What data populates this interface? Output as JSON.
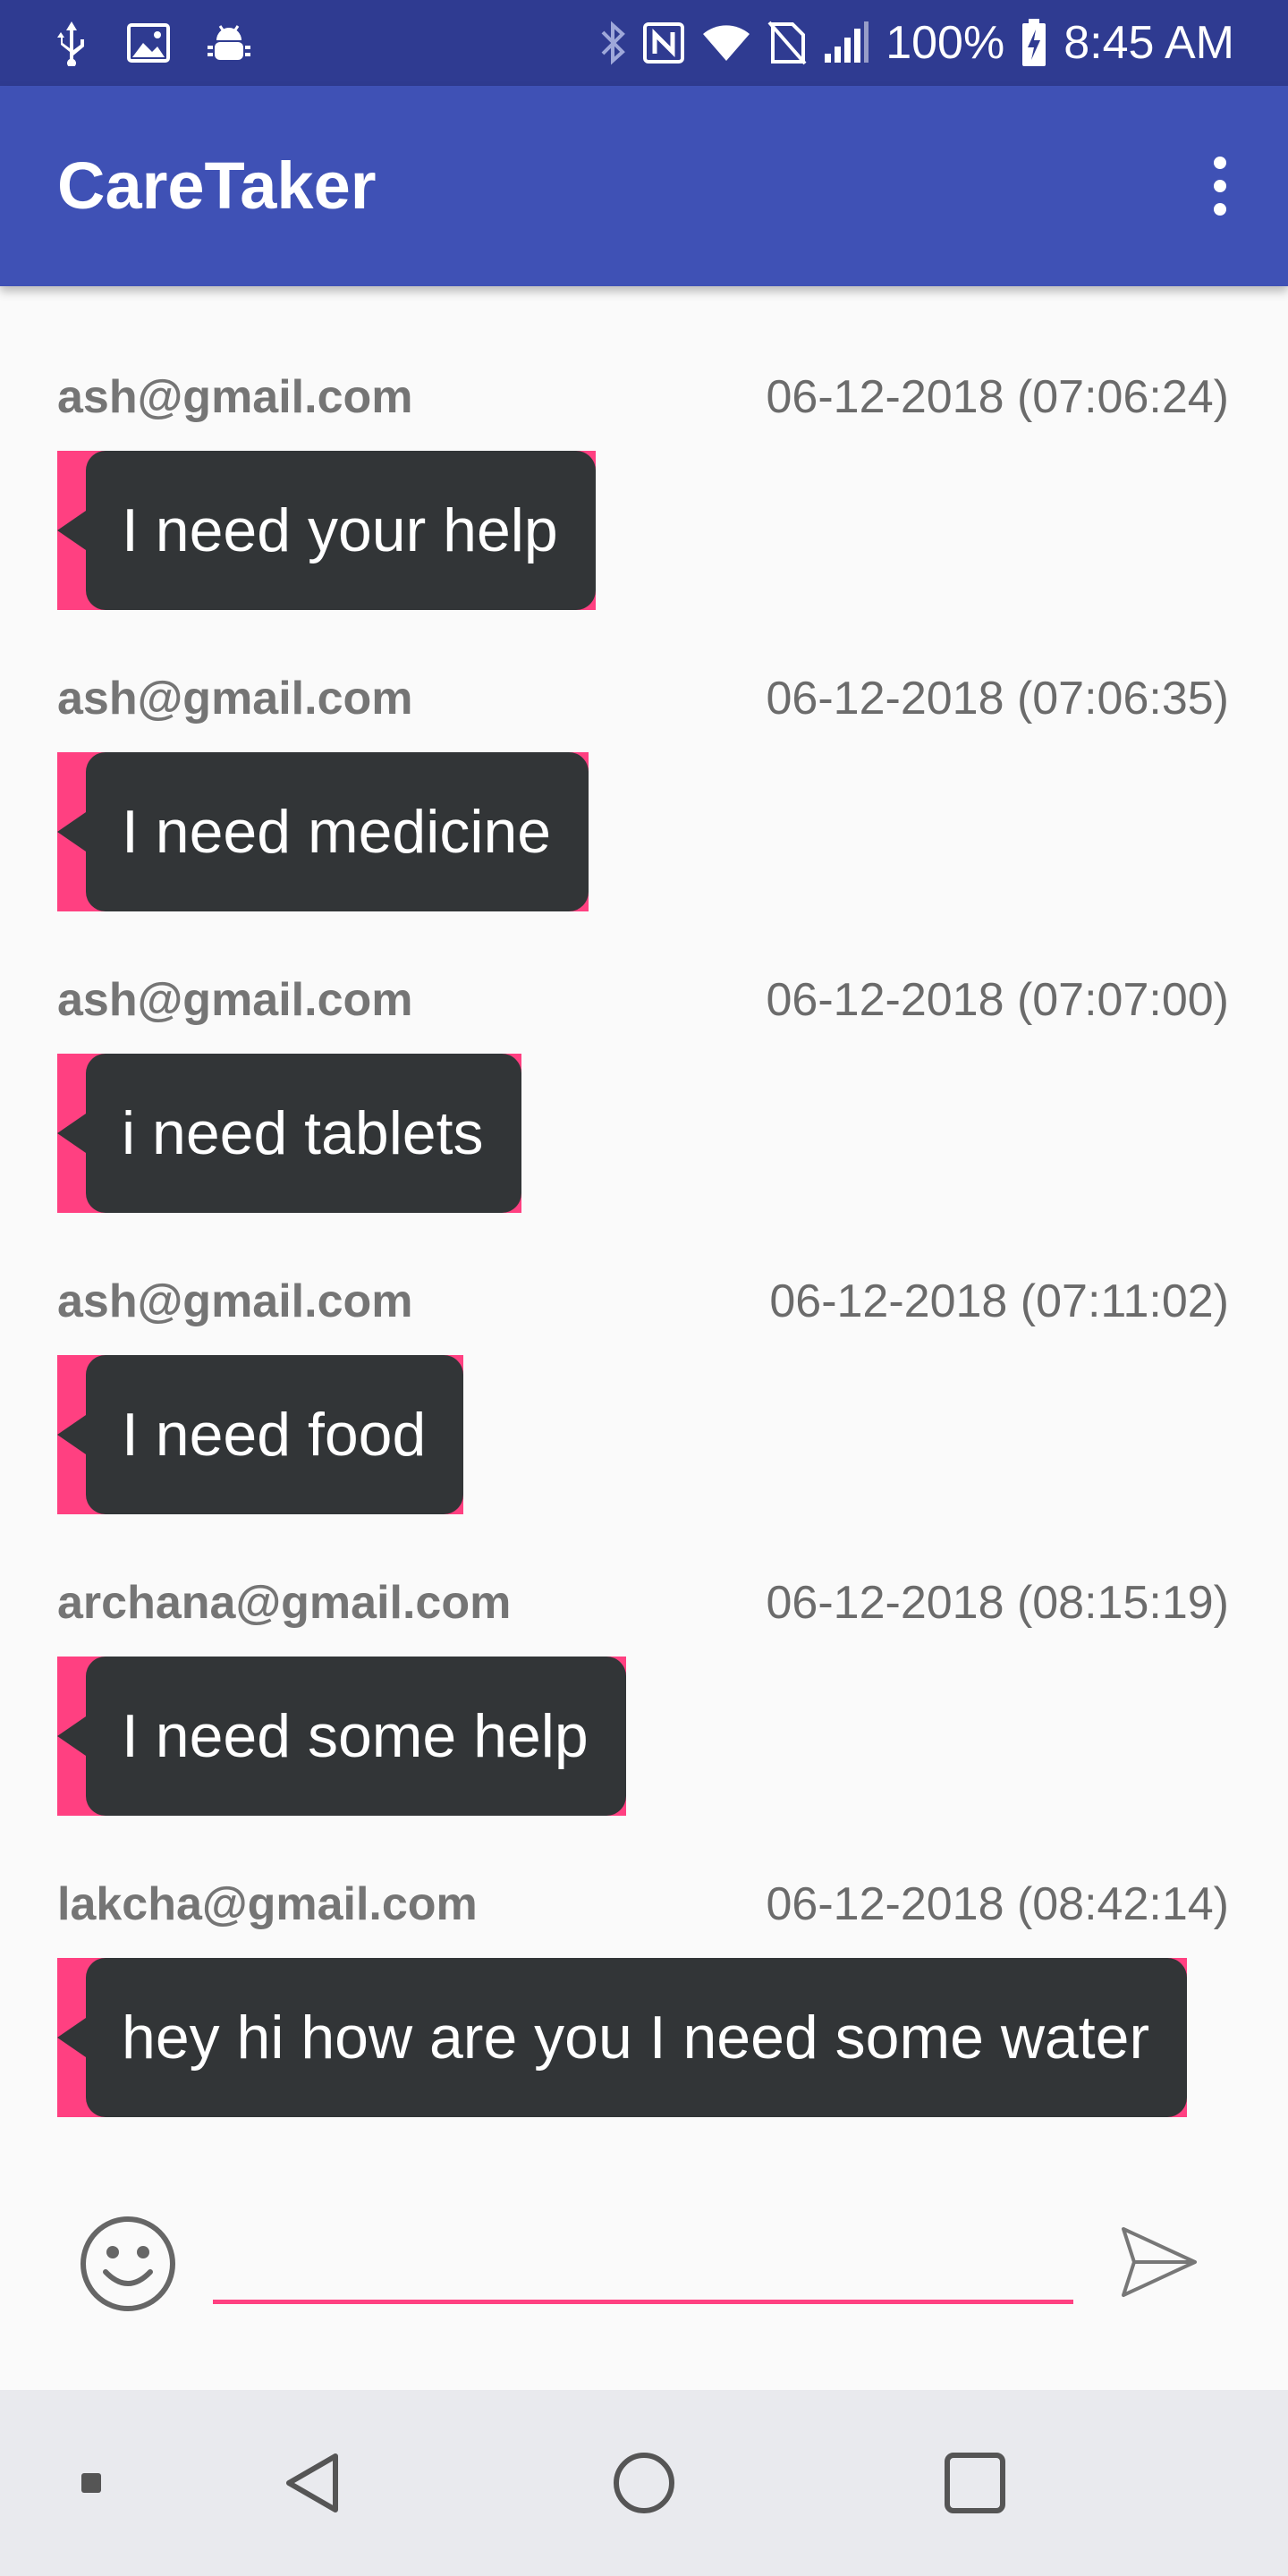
{
  "status_bar": {
    "battery": "100%",
    "time": "8:45 AM",
    "icons": [
      "usb-icon",
      "image-icon",
      "android-debug-icon",
      "bluetooth-icon",
      "nfc-icon",
      "wifi-icon",
      "no-sim-icon",
      "signal-icon",
      "battery-charging-icon"
    ]
  },
  "app_bar": {
    "title": "CareTaker",
    "menu_icon": "more-vert-icon"
  },
  "messages": [
    {
      "sender": "ash@gmail.com",
      "time": "06-12-2018 (07:06:24)",
      "text": "I need your help"
    },
    {
      "sender": "ash@gmail.com",
      "time": "06-12-2018 (07:06:35)",
      "text": "I need medicine"
    },
    {
      "sender": "ash@gmail.com",
      "time": "06-12-2018 (07:07:00)",
      "text": "i need tablets"
    },
    {
      "sender": "ash@gmail.com",
      "time": "06-12-2018 (07:11:02)",
      "text": "I need food"
    },
    {
      "sender": "archana@gmail.com",
      "time": "06-12-2018 (08:15:19)",
      "text": "I need some help"
    },
    {
      "sender": "lakcha@gmail.com",
      "time": "06-12-2018 (08:42:14)",
      "text": "hey hi how are you I need some water"
    }
  ],
  "composer": {
    "value": "",
    "emoji_icon": "emoji-icon",
    "send_icon": "send-icon"
  },
  "nav_bar": {
    "icons": [
      "dot-icon",
      "back-icon",
      "home-icon",
      "recents-icon"
    ]
  },
  "colors": {
    "status_bar": "#2f3b91",
    "app_bar": "#3f51b5",
    "accent": "#ff4081",
    "bubble": "#323537"
  }
}
